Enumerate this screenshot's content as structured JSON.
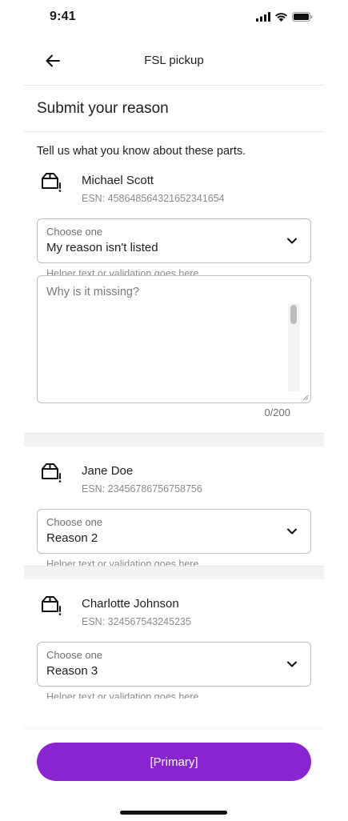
{
  "status": {
    "time": "9:41"
  },
  "nav": {
    "title": "FSL pickup"
  },
  "section": {
    "title": "Submit your reason"
  },
  "intro": "Tell us what you know about these parts.",
  "parts": [
    {
      "name": "Michael Scott",
      "esn": "ESN: 458648564321652341654",
      "select_label": "Choose one",
      "select_value": "My reason isn't listed",
      "helper": "Helper text or validation goes here",
      "textarea_placeholder": "Why is it missing?",
      "counter": "0/200"
    },
    {
      "name": "Jane Doe",
      "esn": "ESN: 23456786756758756",
      "select_label": "Choose one",
      "select_value": "Reason 2",
      "helper": "Helper text or validation goes here"
    },
    {
      "name": "Charlotte Johnson",
      "esn": "ESN: 324567543245235",
      "select_label": "Choose one",
      "select_value": "Reason 3",
      "helper": "Helper text or validation goes here"
    }
  ],
  "footer": {
    "primary_label": "[Primary]"
  },
  "colors": {
    "primary": "#8a24d1",
    "border": "#bdbdbd",
    "muted": "#8a8a8a"
  },
  "icons": {
    "back": "arrow-left-icon",
    "part": "package-alert-icon",
    "chevron": "chevron-down-icon"
  }
}
